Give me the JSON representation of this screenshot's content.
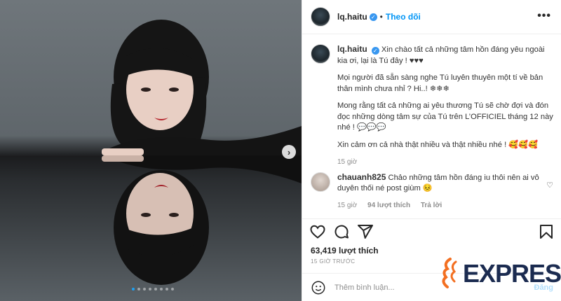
{
  "post": {
    "username": "lq.haitu",
    "follow_label": "Theo dõi",
    "dot_separator": "•",
    "more_label": "•••",
    "caption_paragraphs": [
      "Xin chào tất cả những tâm hồn đáng yêu ngoài kia ơi, lại là Tú đây ! ♥♥♥",
      "Mọi người đã sẵn sàng nghe Tú luyên thuyên một tí về bản thân mình chưa nhỉ ? Hi..! ❄❄❄",
      "Mong rằng tất cả những ai yêu thương Tú sẽ chờ đợi và đón đọc những dòng tâm sự của Tú trên L’OFFICIEL tháng 12 này nhé ! 💬💬💬",
      "Xin cảm ơn cả nhà thật nhiều và thật nhiều nhé ! 🥰🥰🥰"
    ],
    "caption_time": "15 giờ",
    "likes": "63,419 lượt thích",
    "posted_ago": "15 GIỜ TRƯỚC",
    "image_count": 8,
    "active_image": 1
  },
  "comment": {
    "username": "chauanh825",
    "text": "Chảo những tâm hồn đáng iu thôi nên ai vô duyên thối né post giùm 😣",
    "time": "15 giờ",
    "likes": "94 lượt thích",
    "reply_label": "Trả lời"
  },
  "add_comment": {
    "placeholder": "Thêm bình luận...",
    "post_label": "Đăng"
  },
  "watermark": {
    "text": "EXPRESS",
    "color": "#1b2b50"
  },
  "icons": {
    "verified": "verified-badge-icon",
    "like": "heart-icon",
    "comment": "comment-bubble-icon",
    "share": "paper-plane-icon",
    "save": "bookmark-icon",
    "emoji": "smiley-icon",
    "next": "chevron-right-icon"
  },
  "colors": {
    "accent": "#0095f6",
    "verified": "#3897f0",
    "muted": "#8e8e8e"
  }
}
